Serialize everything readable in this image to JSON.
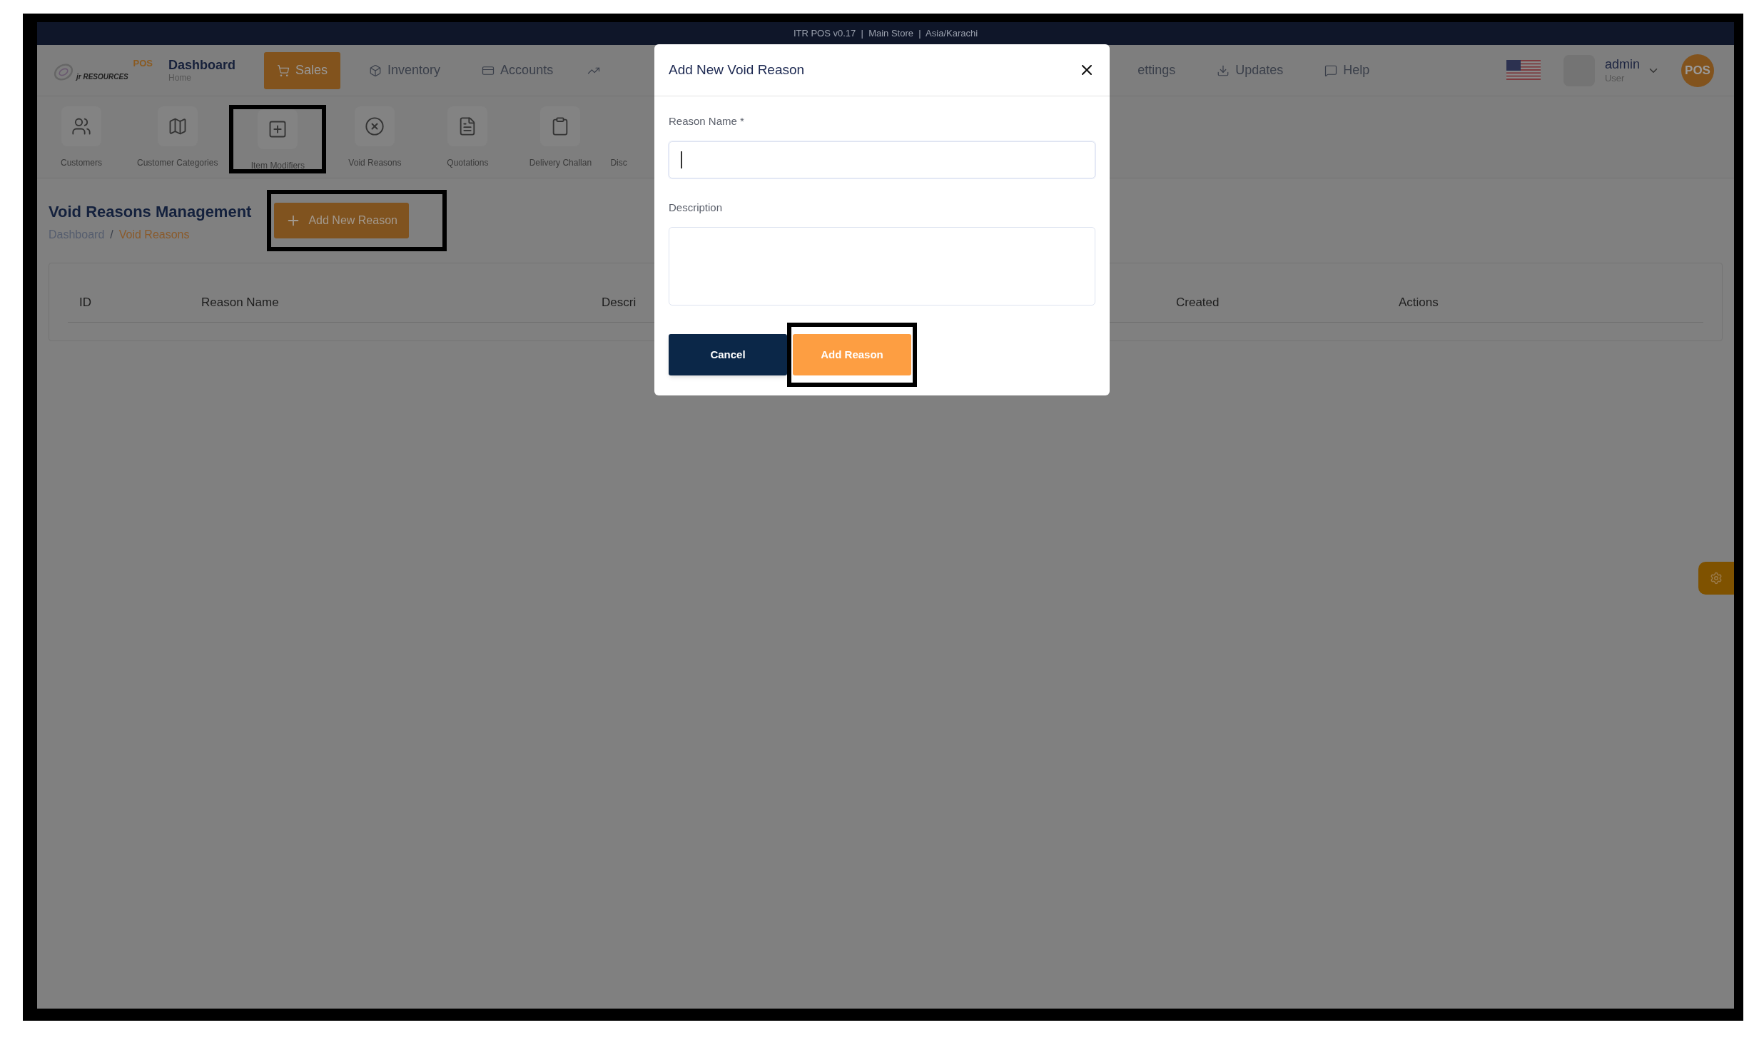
{
  "status_bar": {
    "text": "ITR POS v0.17  |  Main Store  |  Asia/Karachi"
  },
  "logo": {
    "brand": "jr RESOURCES",
    "badge": "POS"
  },
  "nav": {
    "home": {
      "title": "Dashboard",
      "subtitle": "Home"
    },
    "items_left": [
      {
        "label": "Sales",
        "selected": true
      },
      {
        "label": "Inventory",
        "selected": false
      },
      {
        "label": "Accounts",
        "selected": false
      }
    ],
    "items_right": [
      {
        "label": "ettings",
        "selected": false
      },
      {
        "label": "Updates",
        "selected": false
      },
      {
        "label": "Help",
        "selected": false
      }
    ]
  },
  "user": {
    "name": "admin",
    "role": "User",
    "avatar": "POS"
  },
  "toolbar": [
    {
      "label": "Customers",
      "highlighted": false
    },
    {
      "label": "Customer Categories",
      "highlighted": false
    },
    {
      "label": "Item Modifiers",
      "highlighted": true
    },
    {
      "label": "Void Reasons",
      "highlighted": false
    },
    {
      "label": "Quotations",
      "highlighted": false
    },
    {
      "label": "Delivery Challan",
      "highlighted": false
    },
    {
      "label": "Disc",
      "highlighted": false
    }
  ],
  "page": {
    "title": "Void Reasons Management",
    "breadcrumb": [
      {
        "label": "Dashboard",
        "current": false
      },
      {
        "label": "Void Reasons",
        "current": true
      }
    ],
    "breadcrumb_separator": "/",
    "add_button": {
      "label": "Add New Reason",
      "highlighted": true
    }
  },
  "table": {
    "columns": [
      "ID",
      "Reason Name",
      "Descri",
      "Created",
      "Actions"
    ]
  },
  "modal": {
    "title": "Add New Void Reason",
    "fields": [
      {
        "label": "Reason Name *",
        "kind": "input",
        "focused": true
      },
      {
        "label": "Description",
        "kind": "textarea",
        "focused": false
      }
    ],
    "buttons": [
      {
        "label": "Cancel",
        "kind": "secondary",
        "highlighted": false
      },
      {
        "label": "Add Reason",
        "kind": "primary",
        "highlighted": true
      }
    ]
  }
}
